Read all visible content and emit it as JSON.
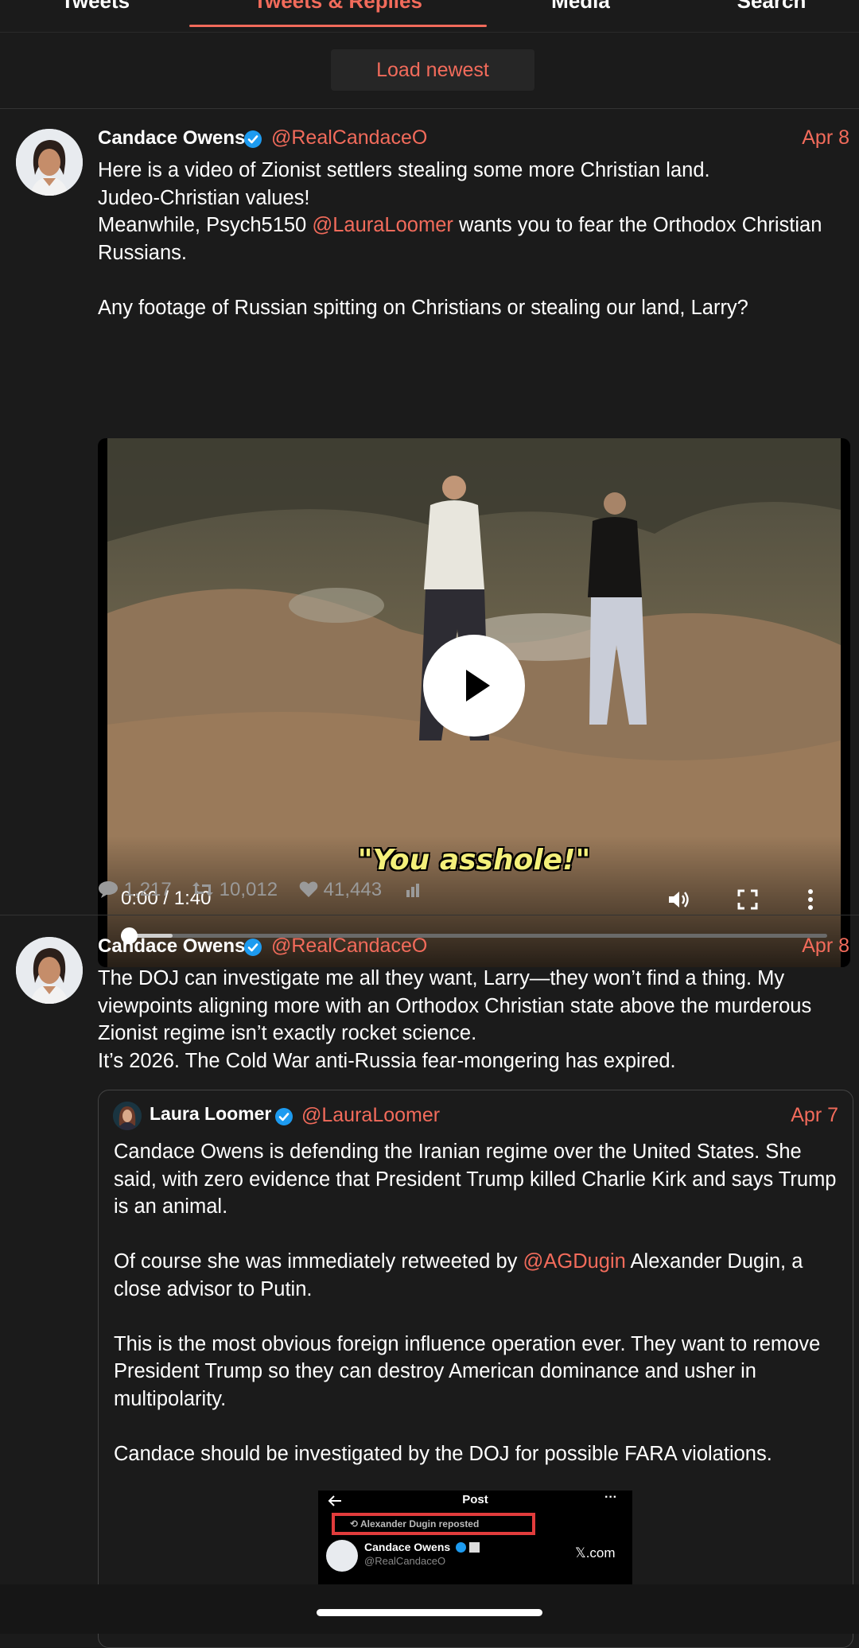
{
  "tabs": [
    {
      "label": "Tweets",
      "active": false
    },
    {
      "label": "Tweets & Replies",
      "active": true
    },
    {
      "label": "Media",
      "active": false
    },
    {
      "label": "Search",
      "active": false
    }
  ],
  "load_newest_label": "Load newest",
  "tweets": [
    {
      "name": "Candace Owens",
      "handle": "@RealCandaceO",
      "date": "Apr 8",
      "lines": [
        "Here is a video of Zionist settlers stealing some more Christian land.",
        "Judeo-Christian values!",
        "Meanwhile, Psych5150 ",
        "@LauraLoomer",
        " wants you to fear the Orthodox Christian Russians.",
        "Any footage of Russian spitting on Christians or stealing our land, Larry?"
      ],
      "video": {
        "subtitle": "\"You asshole!\"",
        "time": "0:00 / 1:40",
        "progress_fraction": 0.0
      },
      "stats": {
        "replies": "1,217",
        "retweets": "10,012",
        "likes": "41,443"
      }
    },
    {
      "name": "Candace Owens",
      "handle": "@RealCandaceO",
      "date": "Apr 8",
      "text1": "The DOJ can investigate me all they want, Larry—they won’t find a thing. My viewpoints aligning more with an Orthodox Christian state above the murderous Zionist regime isn’t exactly rocket science.",
      "text2": "It’s 2026. The Cold War anti-Russia fear-mongering has expired.",
      "quote": {
        "name": "Laura Loomer",
        "handle": "@LauraLoomer",
        "date": "Apr 7",
        "p1": "Candace Owens is defending the Iranian regime over the United States. She said, with zero evidence that President Trump killed Charlie Kirk and says Trump is an animal.",
        "p2_a": "Of course she was immediately retweeted by ",
        "p2_mention": "@AGDugin",
        "p2_b": " Alexander Dugin, a close advisor to Putin.",
        "p3": "This is the most obvious foreign influence operation ever. They want to remove President Trump so they can destroy American dominance and usher in multipolarity.",
        "p4": "Candace should be investigated by the DOJ for possible FARA violations.",
        "image": {
          "title": "Post",
          "repost": "Alexander Dugin reposted",
          "name": "Candace Owens",
          "handle": "@RealCandaceO",
          "brand": "𝕏.com"
        }
      }
    }
  ],
  "colors": {
    "accent": "#f26b5b",
    "background": "#1b1b1b",
    "verified": "#1d9bf0",
    "muted": "#9a9a9a"
  }
}
